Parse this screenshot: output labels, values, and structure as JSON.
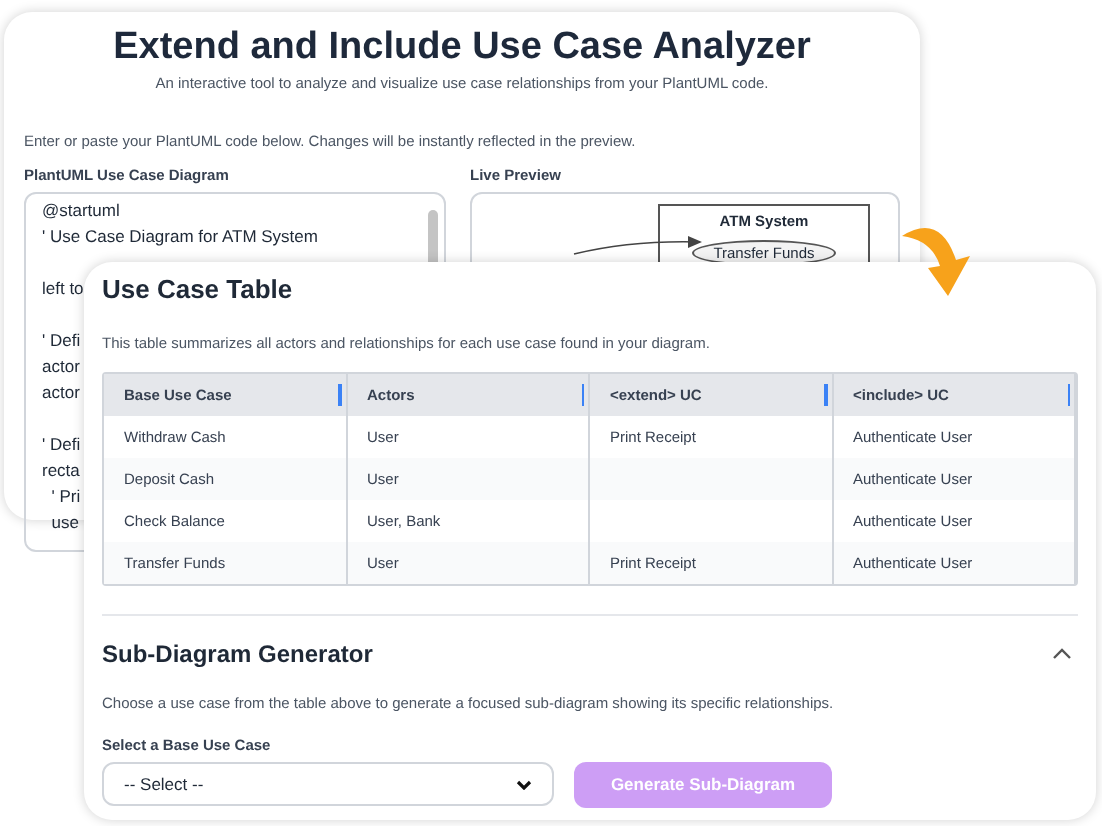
{
  "analyzer": {
    "title": "Extend and Include Use Case Analyzer",
    "subtitle": "An interactive tool to analyze and visualize use case relationships from your PlantUML code.",
    "instructions": "Enter or paste your PlantUML code below. Changes will be instantly reflected in the preview.",
    "editor_label": "PlantUML Use Case Diagram",
    "code_blocks": [
      [
        "@startuml",
        "' Use Case Diagram for ATM System"
      ],
      [
        "left to"
      ],
      [
        "' Defi",
        "actor",
        "actor"
      ],
      [
        "' Defi",
        "recta",
        "  ' Pri",
        "  use"
      ]
    ],
    "preview_label": "Live Preview",
    "preview": {
      "system": "ATM System",
      "use_case": "Transfer Funds"
    }
  },
  "use_case_table": {
    "title": "Use Case Table",
    "description": "This table summarizes all actors and relationships for each use case found in your diagram.",
    "columns": [
      "Base Use Case",
      "Actors",
      "<extend> UC",
      "<include> UC"
    ],
    "rows": [
      [
        "Withdraw Cash",
        "User",
        "Print Receipt",
        "Authenticate User"
      ],
      [
        "Deposit Cash",
        "User",
        "",
        "Authenticate User"
      ],
      [
        "Check Balance",
        "User, Bank",
        "",
        "Authenticate User"
      ],
      [
        "Transfer Funds",
        "User",
        "Print Receipt",
        "Authenticate User"
      ]
    ]
  },
  "sub_diagram": {
    "title": "Sub-Diagram Generator",
    "expanded": true,
    "description": "Choose a use case from the table above to generate a focused sub-diagram showing its specific relationships.",
    "select_label": "Select a Base Use Case",
    "select_value": "-- Select --",
    "button": "Generate Sub-Diagram",
    "button_disabled": true
  }
}
